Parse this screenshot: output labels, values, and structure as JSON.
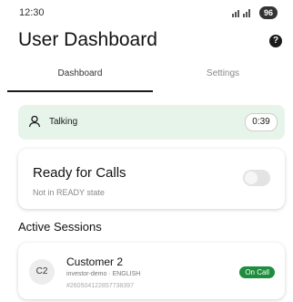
{
  "status_bar": {
    "time": "12:30",
    "battery": "96"
  },
  "header": {
    "title": "User Dashboard",
    "help_glyph": "?"
  },
  "tabs": [
    {
      "label": "Dashboard",
      "active": true
    },
    {
      "label": "Settings",
      "active": false
    }
  ],
  "call_status": {
    "label": "Talking",
    "timer": "0:39",
    "icon": "person-icon",
    "bg_color": "#e6f4ea"
  },
  "ready": {
    "title": "Ready for Calls",
    "subtitle": "Not in READY state",
    "enabled": false
  },
  "sessions": {
    "title": "Active Sessions",
    "items": [
      {
        "initials": "C2",
        "name": "Customer 2",
        "meta": "investor-demo · ENGLISH",
        "id": "#260504122857738397",
        "status": "On Call",
        "status_color": "#1e8e3e"
      }
    ]
  }
}
